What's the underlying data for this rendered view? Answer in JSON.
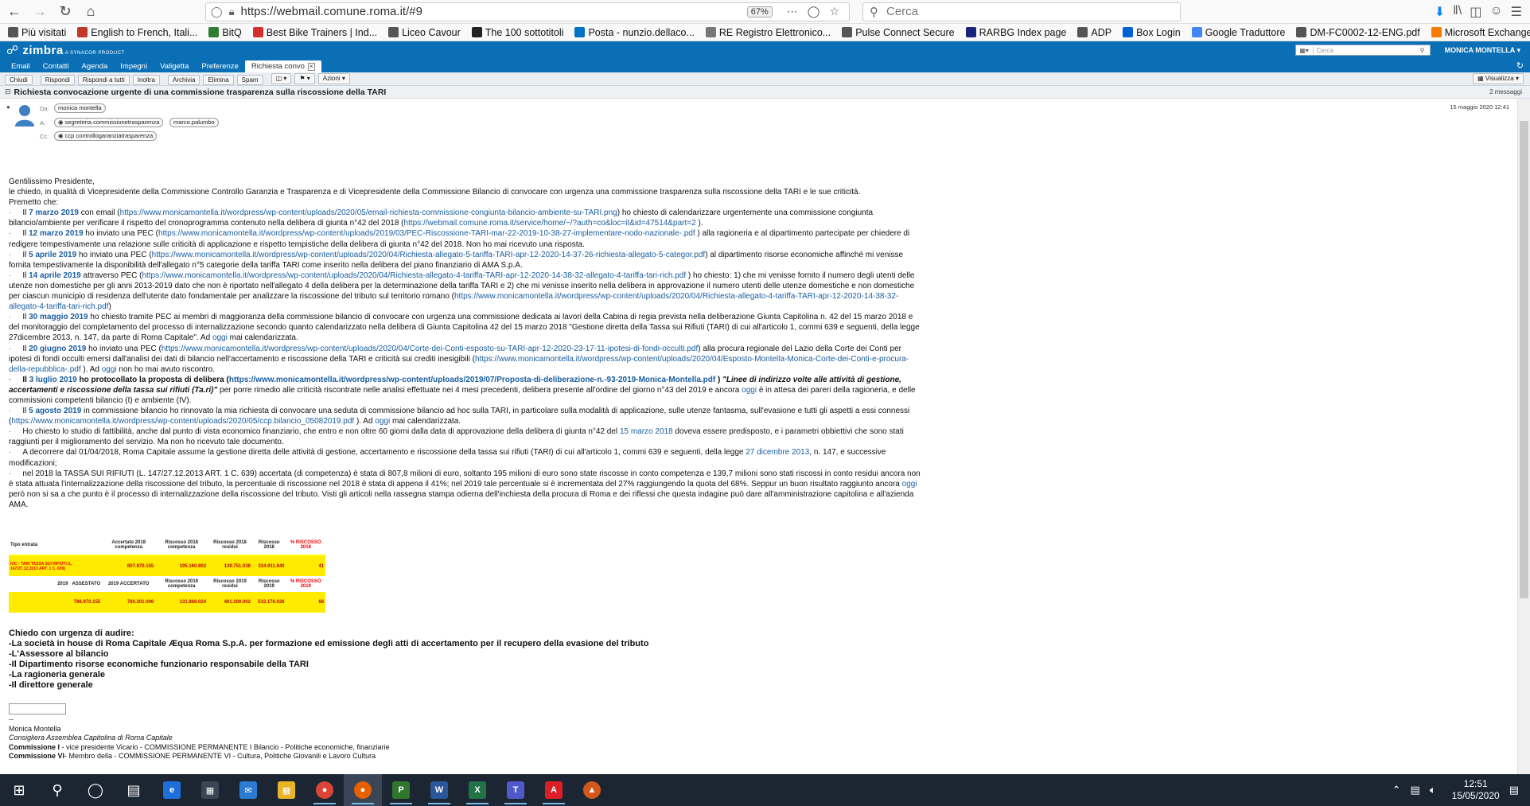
{
  "browser": {
    "url": "https://webmail.comune.roma.it/#9",
    "zoom": "67%",
    "search_placeholder": "Cerca"
  },
  "bookmarks": [
    {
      "label": "Più visitati",
      "icon": "gear-icon",
      "color": "#555555"
    },
    {
      "label": "English to French, Itali...",
      "icon": "wordreference-icon",
      "color": "#c0392b"
    },
    {
      "label": "BitQ",
      "icon": "bitq-icon",
      "color": "#2e7d32"
    },
    {
      "label": "Best Bike Trainers | Ind...",
      "icon": "b-icon",
      "color": "#d32f2f"
    },
    {
      "label": "Liceo Cavour",
      "icon": "school-icon",
      "color": "#555555"
    },
    {
      "label": "The 100 sottotitoli",
      "icon": "film-icon",
      "color": "#222222"
    },
    {
      "label": "Posta - nunzio.dellaco...",
      "icon": "outlook-icon",
      "color": "#0072c6"
    },
    {
      "label": "RE Registro Elettronico...",
      "icon": "registro-icon",
      "color": "#777777"
    },
    {
      "label": "Pulse Connect Secure",
      "icon": "globe-icon",
      "color": "#555555"
    },
    {
      "label": "RARBG Index page",
      "icon": "r-icon",
      "color": "#1a237e"
    },
    {
      "label": "ADP",
      "icon": "globe-icon",
      "color": "#555555"
    },
    {
      "label": "Box Login",
      "icon": "box-icon",
      "color": "#0061d5"
    },
    {
      "label": "Google Traduttore",
      "icon": "translate-icon",
      "color": "#4285f4"
    },
    {
      "label": "DM-FC0002-12-ENG.pdf",
      "icon": "globe-icon",
      "color": "#555555"
    },
    {
      "label": "Microsoft Exchange - ...",
      "icon": "exchange-icon",
      "color": "#f57c00"
    }
  ],
  "zimbra": {
    "logo": "zimbra",
    "logo_sub": "A SYNACOR PRODUCT",
    "search_placeholder": "Cerca",
    "user": "MONICA MONTELLA",
    "tabs": [
      "Email",
      "Contatti",
      "Agenda",
      "Impegni",
      "Valigetta",
      "Preferenze"
    ],
    "active_tab": "Richiesta convo",
    "actions": [
      "Chiudi",
      "Rispondi",
      "Rispondi a tutti",
      "Inoltra",
      "Archivia",
      "Elimina",
      "Spam"
    ],
    "actions_menu": "Azioni",
    "view_menu": "Visualizza"
  },
  "message": {
    "subject": "Richiesta convocazione urgente di una commissione trasparenza sulla riscossione della TARI",
    "count": "2 messaggi",
    "from_label": "Da:",
    "to_label": "A:",
    "cc_label": "Cc:",
    "from": "monica montella",
    "to": [
      "segreteria commissionetrasparenza",
      "marco.palumbo"
    ],
    "cc": "ccp controllogaranziatrasparenza",
    "date": "15 maggio 2020 12:41"
  },
  "body": {
    "greeting": "Gentilissimo Presidente,",
    "intro": "le chiedo, in qualità di Vicepresidente della Commissione Controllo Garanzia e Trasparenza e di Vicepresidente della Commissione Bilancio di convocare con urgenza una commissione trasparenza sulla riscossione della TARI e le sue criticità.",
    "premise": "Premetto che:",
    "p1_date": "7 marzo 2019",
    "p1_a": " con email (",
    "p1_link": "https://www.monicamontella.it/wordpress/wp-content/uploads/2020/05/email-richiesta-commissione-congiunta-bilancio-ambiente-su-TARI.png",
    "p1_b": ") ho chiesto di calendarizzare urgentemente una commissione congiunta bilancio/ambiente per verificare il rispetto del cronoprogramma contenuto nella delibera di giunta n°42 del 2018 (",
    "p1_link2": "https://webmail.comune.roma.it/service/home/~/?auth=co&loc=it&id=47514&part=2",
    "p1_c": " ).",
    "p2_date": "12 marzo 2019",
    "p2_a": " ho inviato una PEC (",
    "p2_link": "https://www.monicamontella.it/wordpress/wp-content/uploads/2019/03/PEC-Riscossione-TARI-mar-22-2019-10-38-27-implementare-nodo-nazionale-.pdf",
    "p2_b": " ) alla ragioneria e al dipartimento partecipate per chiedere di redigere tempestivamente una relazione sulle criticità di applicazione e rispetto tempistiche della delibera di giunta n°42 del 2018. Non ho mai ricevuto una risposta.",
    "p3_date": "5 aprile 2019",
    "p3_a": " ho inviato una PEC (",
    "p3_link": "https://www.monicamontella.it/wordpress/wp-content/uploads/2020/04/Richiesta-allegato-5-tariffa-TARI-apr-12-2020-14-37-26-richiesta-allegato-5-categor.pdf",
    "p3_b": ") al dipartimento risorse economiche affinché mi venisse fornita tempestivamente la disponibilità dell'allegato n°5 categorie della tariffa TARI come inserito nella delibera del piano finanziario di AMA S.p.A.",
    "p4_date": "14 aprile 2019",
    "p4_a": " attraverso PEC (",
    "p4_link": "https://www.monicamontella.it/wordpress/wp-content/uploads/2020/04/Richiesta-allegato-4-tariffa-TARI-apr-12-2020-14-38-32-allegato-4-tariffa-tari-rich.pdf",
    "p4_b": " ) ho chiesto: 1) che mi venisse fornito il numero degli utenti delle utenze non domestiche per gli anni 2013-2019 dato che non è riportato nell'allegato 4 della delibera per la determinazione della tariffa TARI e 2) che mi venisse inserito nella delibera in approvazione il numero utenti delle utenze domestiche e non domestiche per ciascun municipio di residenza dell'utente dato fondamentale per analizzare la riscossione del tributo sul territorio romano (",
    "p4_link2": "https://www.monicamontella.it/wordpress/wp-content/uploads/2020/04/Richiesta-allegato-4-tariffa-TARI-apr-12-2020-14-38-32-allegato-4-tariffa-tari-rich.pdf",
    "p4_c": ")",
    "p5_date": "30 maggio 2019",
    "p5_a": " ho chiesto tramite PEC ai membri di maggioranza della commissione bilancio di convocare con urgenza una commissione dedicata ai lavori della Cabina di regia prevista nella deliberazione Giunta Capitolina n. 42 del 15 marzo 2018 e del monitoraggio del completamento del processo di internalizzazione secondo quanto calendarizzato nella delibera di Giunta Capitolina 42 del 15 marzo 2018 \"Gestione diretta della Tassa sui Rifiuti (TARI) di cui all'articolo 1, commi 639 e seguenti, della legge 27dicembre 2013, n. 147, da parte di Roma Capitale\". Ad ",
    "p5_oggi": "oggi",
    "p5_b": " mai calendarizzata.",
    "p6_date": "20 giugno 2019",
    "p6_a": " ho inviato una PEC (",
    "p6_link": "https://www.monicamontella.it/wordpress/wp-content/uploads/2020/04/Corte-dei-Conti-esposto-su-TARI-apr-12-2020-23-17-11-ipotesi-di-fondi-occulti.pdf",
    "p6_b": ") alla procura regionale del Lazio della Corte dei Conti per ipotesi di fondi occulti emersi dall'analisi dei dati di bilancio nell'accertamento e riscossione della TARI e criticità sui crediti inesigibili (",
    "p6_link2": "https://www.monicamontella.it/wordpress/wp-content/uploads/2020/04/Esposto-Montella-Monica-Corte-dei-Conti-e-procura-della-repubblica-.pdf",
    "p6_c": " ). Ad ",
    "p6_oggi": "oggi",
    "p6_d": " non ho mai avuto riscontro.",
    "p7_date": "3 luglio 2019",
    "p7_a": " ho protocollato la proposta di delibera (",
    "p7_link": "https://www.monicamontella.it/wordpress/wp-content/uploads/2019/07/Proposta-di-deliberazione-n.-93-2019-Monica-Montella.pdf",
    "p7_b": " ) ",
    "p7_quote": "\"Linee di indirizzo volte alle attività di gestione, accertamenti e riscossione della tassa sui rifiuti (Ta.ri)\"",
    "p7_c": " per porre rimedio alle criticità riscontrate nelle analisi effettuate nei 4 mesi precedenti, delibera presente all'ordine del giorno n°43 del 2019 e ancora ",
    "p7_oggi": "oggi",
    "p7_d": " è in attesa dei pareri della ragioneria, e delle commissioni competenti bilancio (I) e ambiente (IV).",
    "p8_date": "5 agosto 2019",
    "p8_a": " in commissione bilancio ho rinnovato la mia richiesta di convocare una seduta di commissione bilancio ad hoc sulla TARI, in particolare sulla modalità di applicazione, sulle utenze fantasma, sull'evasione e tutti gli aspetti a essi connessi (",
    "p8_link": "https://www.monicamontella.it/wordpress/wp-content/uploads/2020/05/ccp.bilancio_05082019.pdf",
    "p8_b": " ). Ad ",
    "p8_oggi": "oggi",
    "p8_c": " mai calendarizzata.",
    "p9_a": "Ho chiesto lo studio di fattibilità, anche dal punto di vista economico finanziario, che entro e non oltre 60 giorni dalla data di approvazione della delibera di giunta n°42 del ",
    "p9_date": "15 marzo 2018",
    "p9_b": " doveva essere predisposto, e i parametri obbiettivi che sono stati raggiunti per il miglioramento del servizio. Ma non ho ricevuto tale documento.",
    "p10_a": "A decorrere dal 01/04/2018, Roma Capitale assume la gestione diretta delle attività di gestione, accertamento e riscossione della tassa sui rifiuti (TARI) di cui all'articolo 1, commi 639 e seguenti, della legge ",
    "p10_date": "27 dicembre 2013",
    "p10_b": ", n. 147, e successive modificazioni;",
    "p11": "nel 2018 la TASSA SUI RIFIUTI (L. 147/27.12.2013 ART. 1 C. 639) accertata (di competenza) è stata di 807,8 milioni di euro, soltanto 195 milioni di euro sono state riscosse in conto competenza e 139,7 milioni sono stati riscossi in conto residui ancora non è stata attuata l'internalizzazione della riscossione del tributo, la percentuale di riscossione nel 2018 è stata di appena il 41%; nel 2019 tale percentuale si è incrementata del 27% raggiungendo la quota del 68%.  Seppur un buon risultato raggiunto ancora ",
    "p11_oggi": "oggi",
    "p11_b": " però non si sa a che punto è il processo di internalizzazione della riscossione del tributo. Visti gli articoli nella rassegna stampa odierna dell'inchiesta della procura di Roma e dei riflessi che questa indagine può dare all'amministrazione capitolina e all'azienda AMA."
  },
  "table": {
    "h1": [
      "Tipo entrata",
      "Accertato 2018 competenza",
      "Riscosso 2018 competenza",
      "Riscosso 2018 residui",
      "Riscosso 2018",
      "% RISCOSSO 2018"
    ],
    "r1": [
      "IUC - TARI TASSA SUI RIFIUTI (L. 147/27.12.2013 ART. 1 C. 639)",
      "807.870.155",
      "195.160.802",
      "139.751.038",
      "334.911.840",
      "41"
    ],
    "h2": [
      "2019",
      "ASSESTATO",
      "2019 ACCERTATO",
      "Riscosso 2019 competenza",
      "Riscosso 2019 residui",
      "Riscosso 2019",
      "% RISCOSSO 2019"
    ],
    "r2": [
      "786.970.155",
      "780.201.006",
      "131.868.024",
      "401.300.002",
      "533.176.026",
      "68"
    ]
  },
  "closing": {
    "title": "Chiedo con urgenza di audire:",
    "items": [
      "-La società in house di Roma Capitale Æqua Roma S.p.A. per formazione ed emissione degli atti di accertamento per il recupero della evasione del tributo",
      "-L'Assessore al bilancio",
      "-Il Dipartimento risorse economiche funzionario responsabile della TARI",
      "-La ragioneria generale",
      "-Il direttore generale"
    ]
  },
  "signature": {
    "sep": "--",
    "name": "Monica Montella",
    "role": "Consigliera Assemblea Capitolina di Roma Capitale",
    "c1_label": "Commissione I",
    "c1_text": " - vice presidente Vicario - COMMISSIONE PERMANENTE I Bilancio - Politiche economiche, finanziarie",
    "c2_label": "Commissione VI",
    "c2_text": "- Membro della - COMMISSIONE PERMANENTE VI - Cultura, Politiche Giovanili e Lavoro Cultura"
  },
  "taskbar": {
    "time": "12:51",
    "date": "15/05/2020"
  }
}
